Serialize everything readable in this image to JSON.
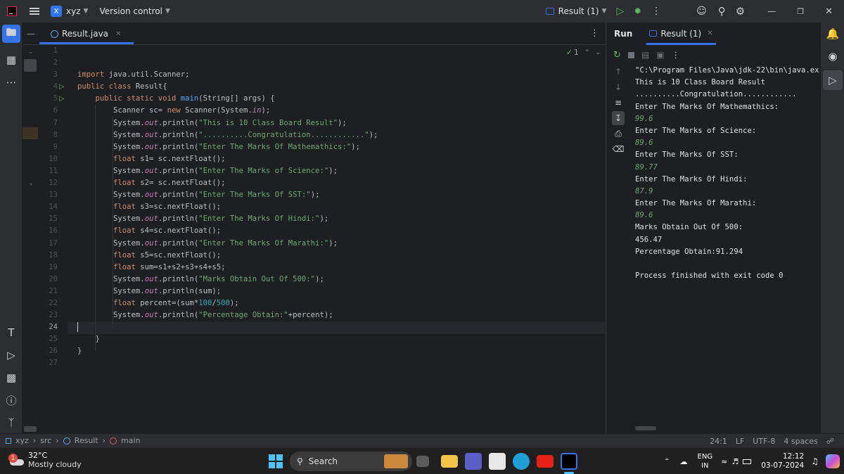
{
  "titlebar": {
    "project_badge": "X",
    "project_name": "xyz",
    "vcs_label": "Version control",
    "run_config": "Result (1)"
  },
  "editor": {
    "tab_label": "Result.java",
    "inspection_count": "1",
    "line_numbers": [
      "1",
      "2",
      "3",
      "4",
      "5",
      "6",
      "7",
      "8",
      "9",
      "10",
      "11",
      "12",
      "13",
      "14",
      "15",
      "16",
      "17",
      "18",
      "19",
      "20",
      "21",
      "22",
      "23",
      "24",
      "25",
      "26",
      "27"
    ]
  },
  "code": {
    "import_kw": "import",
    "import_rest": " java.util.Scanner;",
    "class_decl_kw": "public class",
    "class_decl_rest": " Result{",
    "main_kw": "public static void",
    "main_name": "main",
    "main_rest": "(String[] args) {",
    "scanner_a": "Scanner sc= ",
    "scanner_new": "new",
    "scanner_b": " Scanner(System.",
    "scanner_in": "in",
    "scanner_c": ");",
    "sysout_prefix": "System.",
    "sysout_out": "out",
    "sysout_println": ".println(",
    "str1": "\"This is 10 Class Board Result\"",
    "str2": "\"..........Congratulation............\"",
    "str3": "\"Enter The Marks Of Mathemathics:\"",
    "str4": "\"Enter The Marks of Science:\"",
    "str5": "\"Enter The Marks Of SST:\"",
    "str6": "\"Enter The Marks Of Hindi:\"",
    "str7": "\"Enter The Marks Of Marathi:\"",
    "str8": "\"Marks Obtain Out Of 500:\"",
    "str9": "\"Percentage Obtain:\"",
    "close": ");",
    "float_kw": "float",
    "s1": " s1= sc.nextFloat();",
    "s2": " s2= sc.nextFloat();",
    "s3": " s3=sc.nextFloat();",
    "s4": " s4=sc.nextFloat();",
    "s5": " s5=sc.nextFloat();",
    "sum": " sum=s1+s2+s3+s4+s5;",
    "println_sum": ".println(sum);",
    "percent_a": " percent=(sum*",
    "percent_100": "100",
    "percent_slash": "/",
    "percent_500": "500",
    "percent_b": ");",
    "plus_percent": "+percent);",
    "brace": "}"
  },
  "run_panel": {
    "title": "Run",
    "tab_label": "Result (1)",
    "console": [
      {
        "text": "\"C:\\Program Files\\Java\\jdk-22\\bin\\java.exe\"",
        "type": "out"
      },
      {
        "text": "This is 10 Class Board Result",
        "type": "out"
      },
      {
        "text": "..........Congratulation............",
        "type": "out"
      },
      {
        "text": "Enter The Marks Of Mathemathics:",
        "type": "out"
      },
      {
        "text": "99.6",
        "type": "in"
      },
      {
        "text": "Enter The Marks of Science:",
        "type": "out"
      },
      {
        "text": "89.6",
        "type": "in"
      },
      {
        "text": "Enter The Marks Of SST:",
        "type": "out"
      },
      {
        "text": "89.77",
        "type": "in"
      },
      {
        "text": "Enter The Marks Of Hindi:",
        "type": "out"
      },
      {
        "text": "87.9",
        "type": "in"
      },
      {
        "text": "Enter The Marks Of Marathi:",
        "type": "out"
      },
      {
        "text": "89.6",
        "type": "in"
      },
      {
        "text": "Marks Obtain Out Of 500:",
        "type": "out"
      },
      {
        "text": "456.47",
        "type": "out"
      },
      {
        "text": "Percentage Obtain:91.294",
        "type": "out"
      },
      {
        "text": "",
        "type": "out"
      },
      {
        "text": "Process finished with exit code 0",
        "type": "out"
      }
    ]
  },
  "statusbar": {
    "crumb_project": "xyz",
    "crumb_src": "src",
    "crumb_class": "Result",
    "crumb_method": "main",
    "position": "24:1",
    "line_sep": "LF",
    "encoding": "UTF-8",
    "indent": "4 spaces"
  },
  "taskbar": {
    "weather_temp": "32°C",
    "weather_desc": "Mostly cloudy",
    "weather_badge": "1",
    "search_label": "Search",
    "lang_top": "ENG",
    "lang_bottom": "IN",
    "time": "12:12",
    "date": "03-07-2024"
  },
  "colors": {
    "accent": "#3574f0",
    "run_green": "#5fb865",
    "keyword": "#cf8e6d",
    "string": "#6aab73"
  }
}
